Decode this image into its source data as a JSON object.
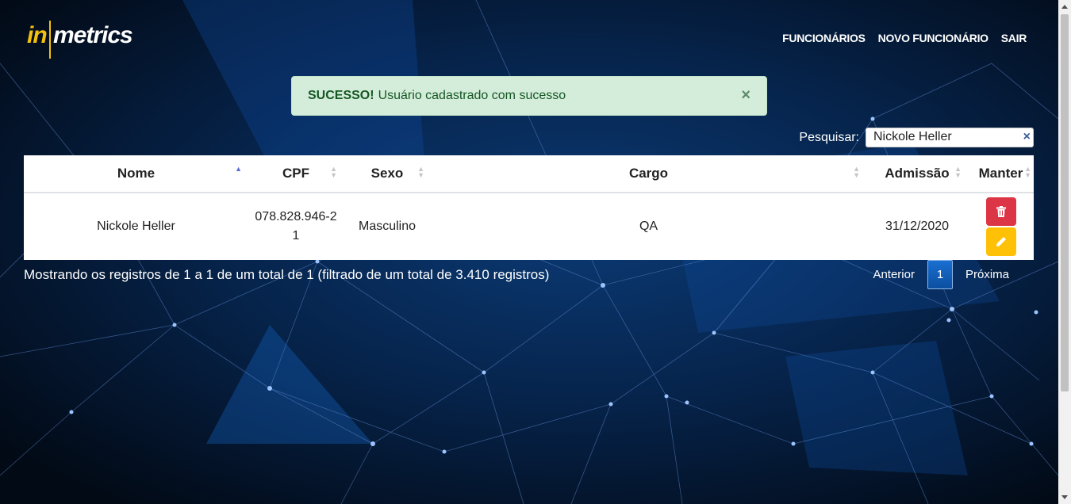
{
  "logo": {
    "prefix": "in",
    "suffix": "metrics"
  },
  "nav": {
    "funcionarios": "FUNCIONÁRIOS",
    "novo": "NOVO FUNCIONÁRIO",
    "sair": "SAIR"
  },
  "alert": {
    "title": "SUCESSO!",
    "message": "Usuário cadastrado com sucesso",
    "close": "×"
  },
  "search": {
    "label": "Pesquisar:",
    "value": "Nickole Heller",
    "clear": "×"
  },
  "table": {
    "headers": [
      "Nome",
      "CPF",
      "Sexo",
      "Cargo",
      "Admissão",
      "Manter"
    ],
    "sorted_column": "Nome",
    "rows": [
      {
        "nome": "Nickole Heller",
        "cpf": "078.828.946-21",
        "sexo": "Masculino",
        "cargo": "QA",
        "admissao": "31/12/2020"
      }
    ]
  },
  "info": "Mostrando os registros de 1 a 1 de um total de 1 (filtrado de um total de 3.410 registros)",
  "pagination": {
    "prev": "Anterior",
    "current": "1",
    "next": "Próxima"
  },
  "colors": {
    "accent": "#f4c20d",
    "danger": "#dc3545",
    "warning": "#ffc107",
    "success_bg": "#d4edda",
    "success_text": "#155724"
  },
  "icons": {
    "delete": "trash-icon",
    "edit": "pencil-icon",
    "sort": "sort-arrows-icon"
  }
}
